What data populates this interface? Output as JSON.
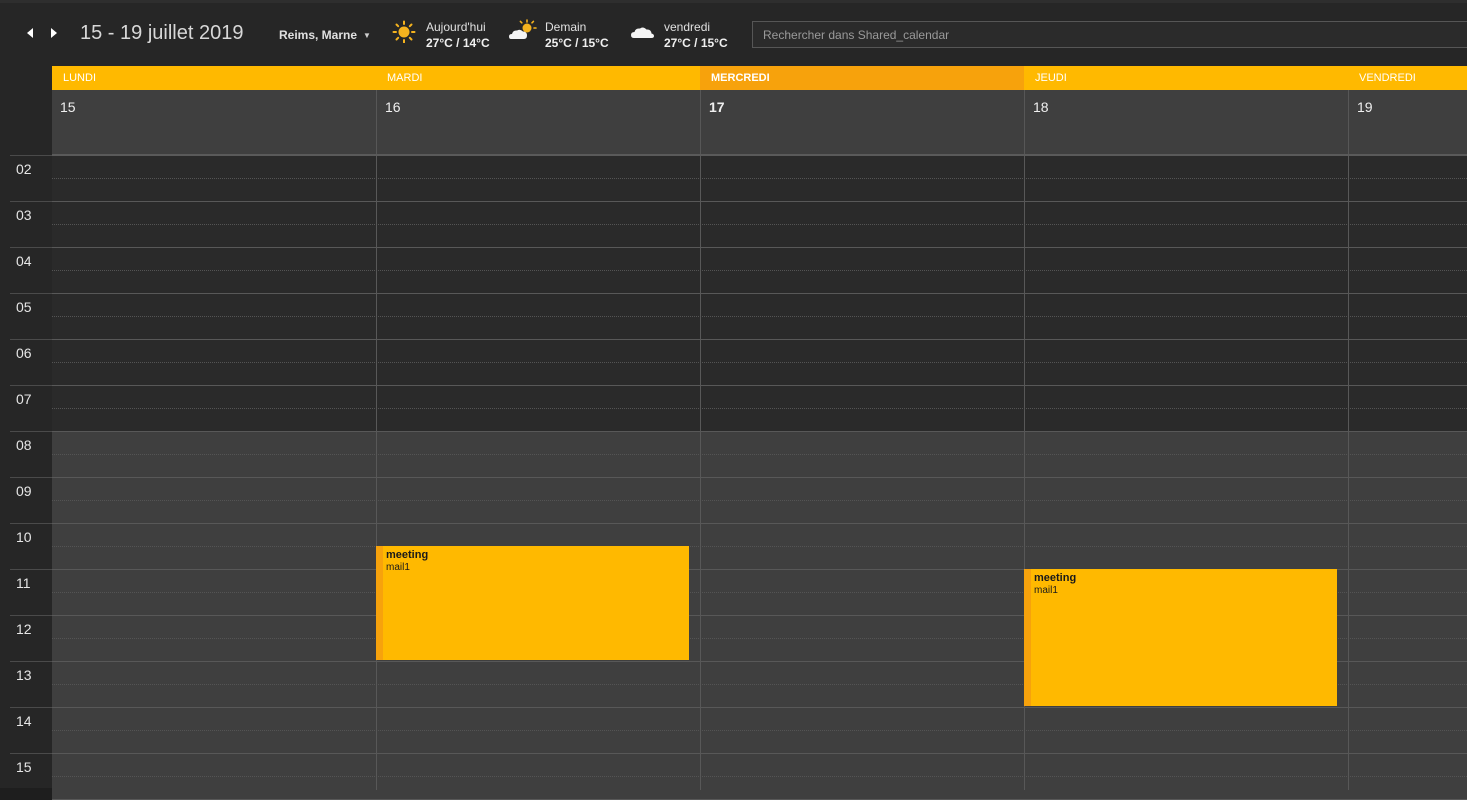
{
  "header": {
    "range_title": "15 - 19 juillet 2019",
    "location": "Reims, Marne",
    "search_placeholder": "Rechercher dans Shared_calendar",
    "weather": [
      {
        "day": "Aujourd'hui",
        "temp": "27°C / 14°C",
        "icon": "sun-icon"
      },
      {
        "day": "Demain",
        "temp": "25°C / 15°C",
        "icon": "partly-cloudy-icon"
      },
      {
        "day": "vendredi",
        "temp": "27°C / 15°C",
        "icon": "cloudy-icon"
      }
    ]
  },
  "days": [
    {
      "name": "LUNDI",
      "date": "15"
    },
    {
      "name": "MARDI",
      "date": "16"
    },
    {
      "name": "MERCREDI",
      "date": "17",
      "today": true
    },
    {
      "name": "JEUDI",
      "date": "18"
    },
    {
      "name": "VENDREDI",
      "date": "19"
    }
  ],
  "hours": [
    "02",
    "03",
    "04",
    "05",
    "06",
    "07",
    "08",
    "09",
    "10",
    "11",
    "12",
    "13",
    "14",
    "15"
  ],
  "events": [
    {
      "title": "meeting",
      "subtitle": "mail1",
      "day": "MARDI",
      "start": "10:30",
      "end": "13:00"
    },
    {
      "title": "meeting",
      "subtitle": "mail1",
      "day": "JEUDI",
      "start": "11:00",
      "end": "14:00"
    }
  ],
  "colors": {
    "accent": "#ffb900",
    "today_accent": "#f7a20c",
    "background": "#1e1e1e"
  }
}
